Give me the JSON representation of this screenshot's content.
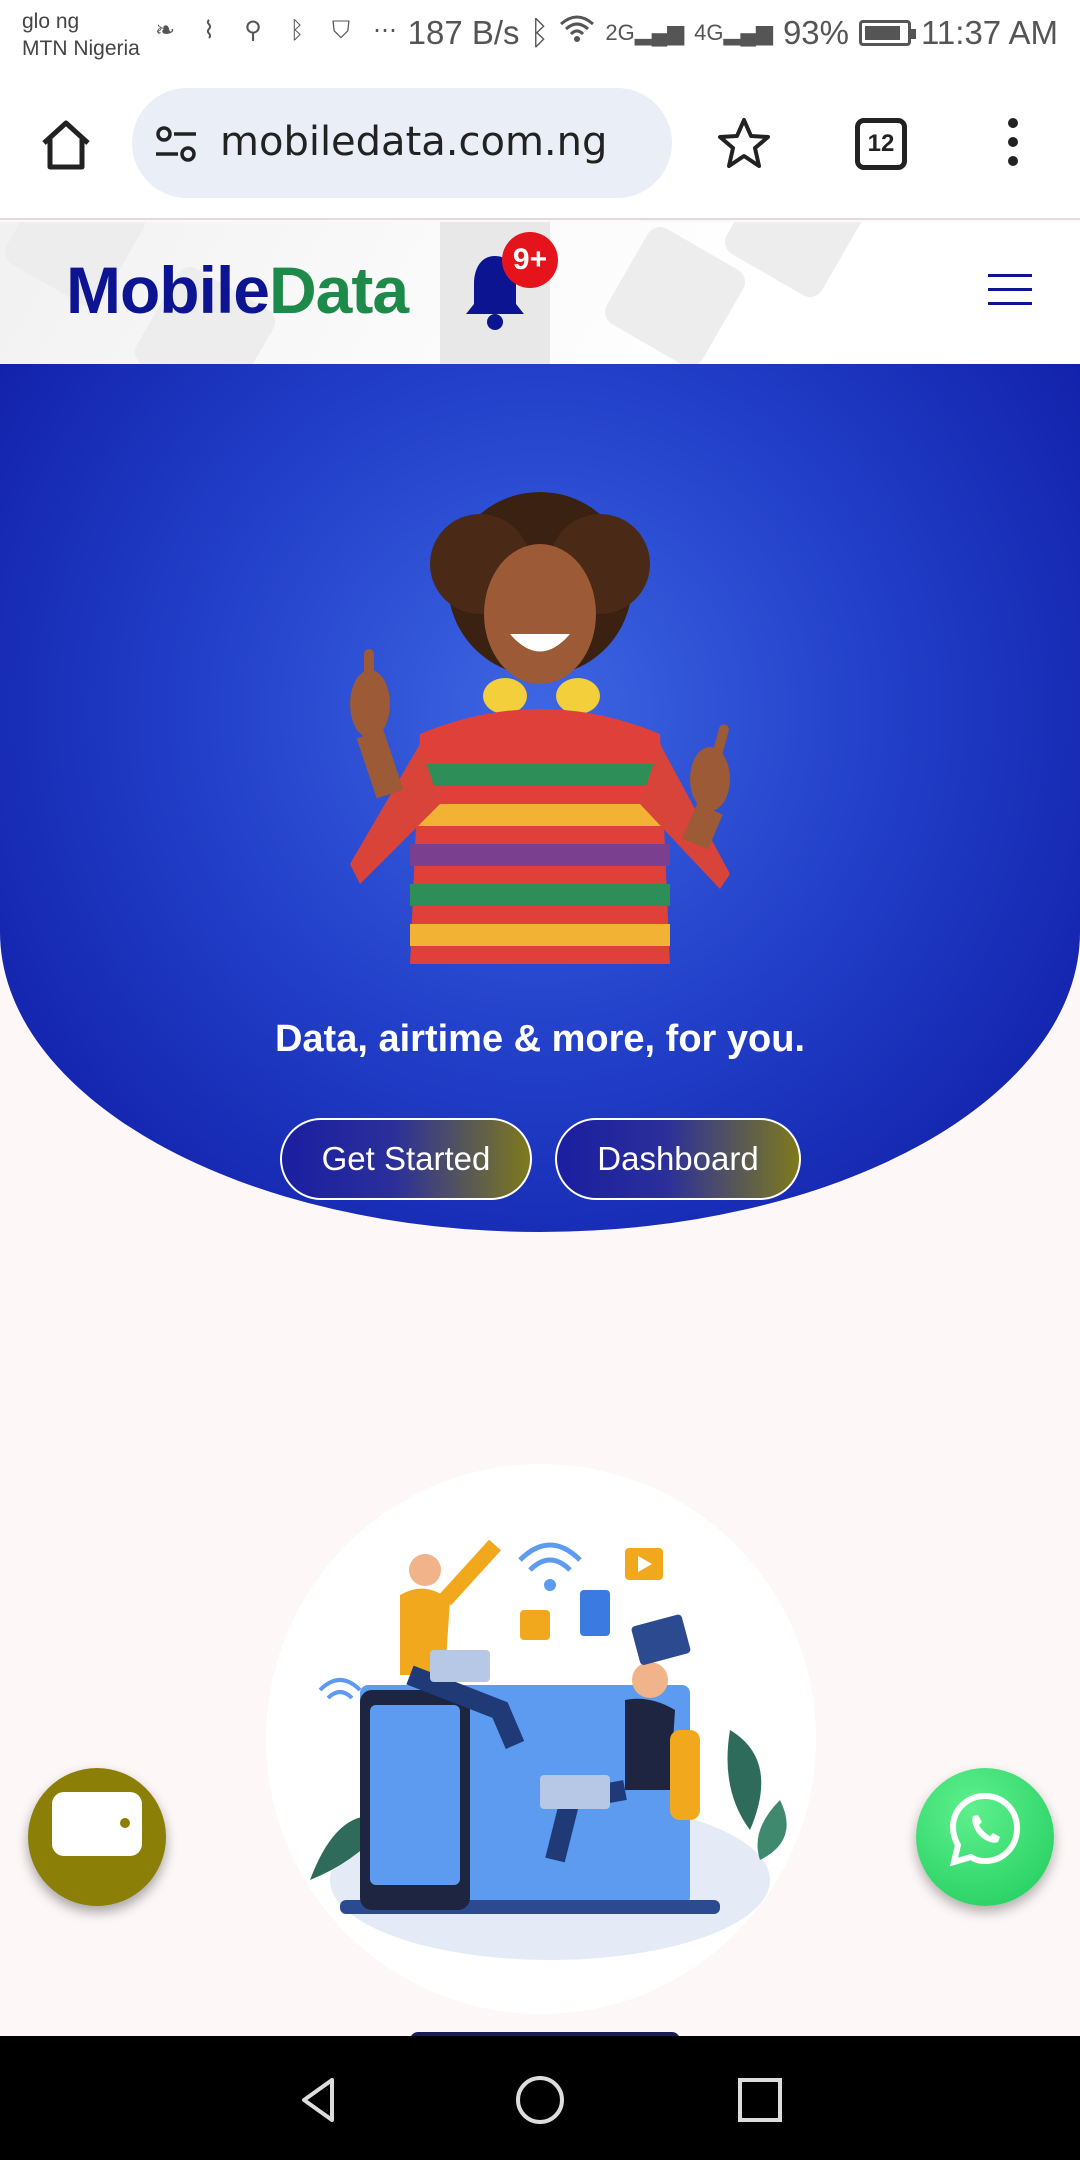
{
  "status_bar": {
    "carrier_line1": "glo ng",
    "carrier_line2": "MTN Nigeria",
    "speed": "187 B/s",
    "net_2g": "2G",
    "net_4g": "4G",
    "battery": "93%",
    "time": "11:37 AM"
  },
  "browser": {
    "url": "mobiledata.com.ng",
    "tab_count": "12"
  },
  "header": {
    "logo_part1": "Mobile",
    "logo_part2": "Data",
    "notification_badge": "9+"
  },
  "hero": {
    "title": "Data, airtime & more, for you.",
    "get_started_label": "Get Started",
    "dashboard_label": "Dashboard"
  },
  "colors": {
    "brand_blue": "#0c1491",
    "brand_green": "#1d8a4a",
    "hero_blue": "#2240c9",
    "wallet_olive": "#8b7f08",
    "whatsapp_green": "#1fcb5c",
    "badge_red": "#e5141c"
  }
}
